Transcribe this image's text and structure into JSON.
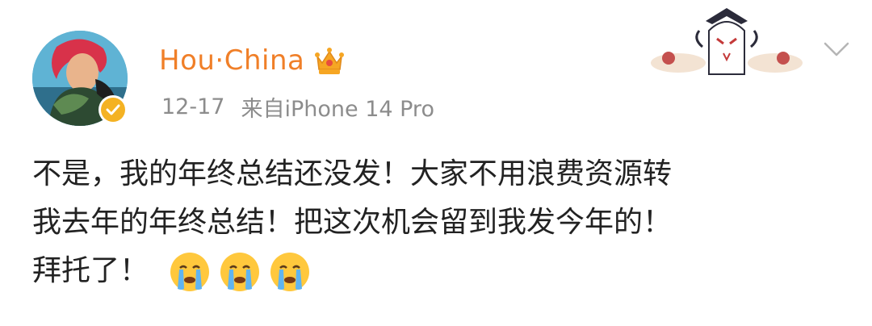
{
  "post": {
    "username": "Hou·China",
    "date": "12-17",
    "source": "来自iPhone 14 Pro",
    "content_lines": [
      "不是，我的年终总结还没发！大家不用浪费资源转",
      "我去年的年终总结！把这次机会留到我发今年的！",
      "拜托了！"
    ],
    "emoji_names": [
      "crying-emoji",
      "crying-emoji",
      "crying-emoji"
    ]
  },
  "colors": {
    "username": "#f07f28",
    "meta": "#8c8c8c",
    "verified": "#f4b223",
    "text": "#222222"
  }
}
